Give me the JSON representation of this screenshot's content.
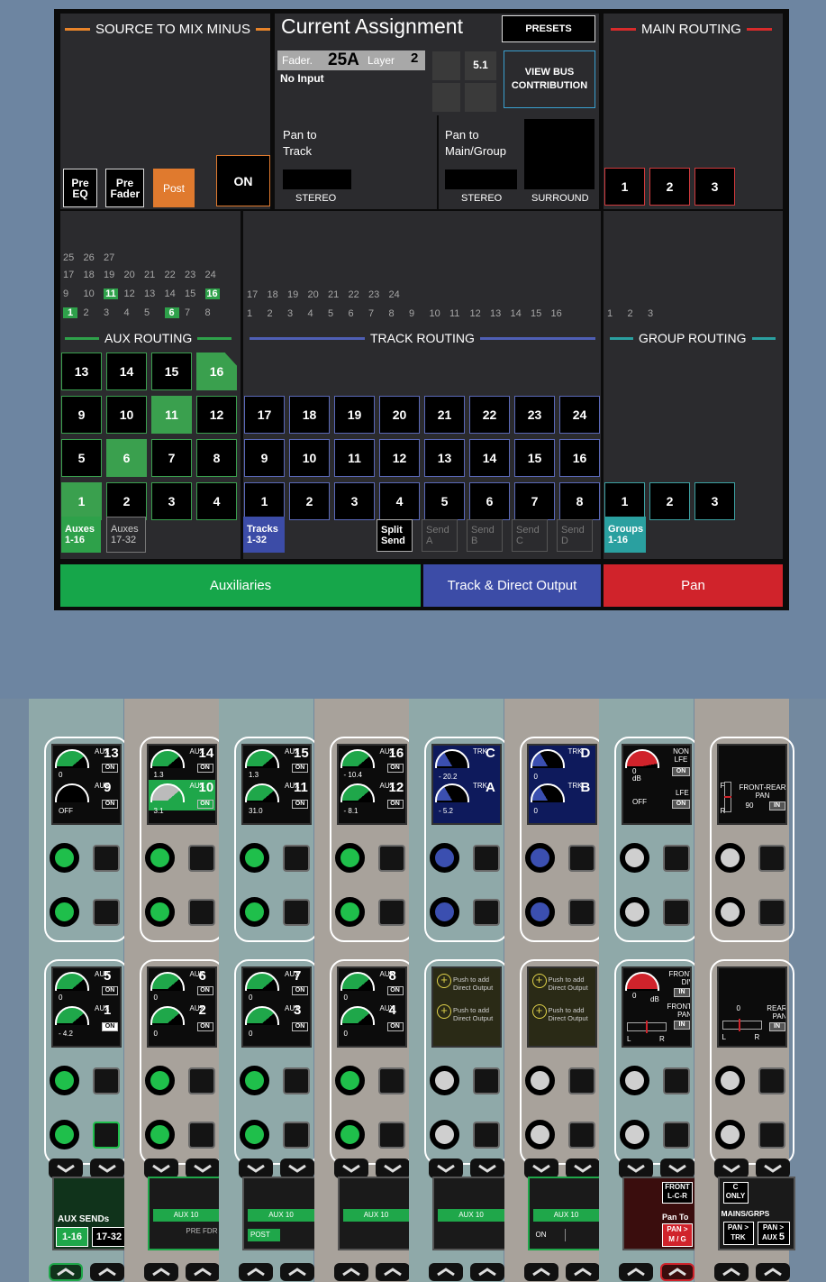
{
  "top": {
    "source_header": "SOURCE TO MIX MINUS",
    "current_assignment": "Current Assignment",
    "presets": "PRESETS",
    "main_routing": "MAIN ROUTING",
    "fader_label": "Fader.",
    "fader_value": "25A",
    "layer_label": "Layer",
    "layer_value": "2",
    "no_input": "No Input",
    "five_one": "5.1",
    "view_bus": "VIEW BUS CONTRIBUTION",
    "pan_to_track": "Pan to Track",
    "pan_to_main": "Pan to Main/Group",
    "stereo1": "STEREO",
    "stereo2": "STEREO",
    "surround": "SURROUND",
    "pre_eq": "Pre EQ",
    "pre_fader": "Pre Fader",
    "post": "Post",
    "on": "ON",
    "main_buttons": [
      "1",
      "2",
      "3"
    ],
    "aux_nums_row4": [
      "25",
      "26",
      "27"
    ],
    "aux_nums_row3": [
      "17",
      "18",
      "19",
      "20",
      "21",
      "22",
      "23",
      "24"
    ],
    "aux_nums_row2": [
      "9",
      "10",
      "11",
      "12",
      "13",
      "14",
      "15",
      "16"
    ],
    "aux_nums_row1": [
      "1",
      "2",
      "3",
      "4",
      "5",
      "6",
      "7",
      "8"
    ],
    "trk_nums_row2": [
      "17",
      "18",
      "19",
      "20",
      "21",
      "22",
      "23",
      "24"
    ],
    "trk_nums_row1": [
      "1",
      "2",
      "3",
      "4",
      "5",
      "6",
      "7",
      "8",
      "9",
      "10",
      "11",
      "12",
      "13",
      "14",
      "15",
      "16"
    ],
    "grp_nums": [
      "1",
      "2",
      "3"
    ],
    "aux_routing": "AUX ROUTING",
    "track_routing": "TRACK ROUTING",
    "group_routing": "GROUP ROUTING",
    "aux_grid": [
      "13",
      "14",
      "15",
      "16",
      "9",
      "10",
      "11",
      "12",
      "5",
      "6",
      "7",
      "8",
      "1",
      "2",
      "3",
      "4"
    ],
    "track_grid": [
      "17",
      "18",
      "19",
      "20",
      "21",
      "22",
      "23",
      "24",
      "9",
      "10",
      "11",
      "12",
      "13",
      "14",
      "15",
      "16",
      "1",
      "2",
      "3",
      "4",
      "5",
      "6",
      "7",
      "8"
    ],
    "group_grid": [
      "1",
      "2",
      "3"
    ],
    "auxes_1_16": "Auxes 1-16",
    "auxes_17_32": "Auxes 17-32",
    "tracks_1_32": "Tracks 1-32",
    "split_send": "Split Send",
    "send_a": "Send A",
    "send_b": "Send B",
    "send_c": "Send C",
    "send_d": "Send D",
    "groups_1_16": "Groups 1-16",
    "tab_aux": "Auxiliaries",
    "tab_track": "Track & Direct Output",
    "tab_pan": "Pan",
    "colors": {
      "aux": "#16a64a",
      "track": "#3c4ca7",
      "pan": "#d0232b",
      "group": "#2aa0a0"
    }
  },
  "console": {
    "upper": [
      {
        "a": "13",
        "av": "0",
        "b": "9",
        "bv": "OFF"
      },
      {
        "a": "14",
        "av": "1.3",
        "b": "10",
        "bv": "3.1"
      },
      {
        "a": "15",
        "av": "1.3",
        "b": "11",
        "bv": "31.0"
      },
      {
        "a": "16",
        "av": "- 10.4",
        "b": "12",
        "bv": "- 8.1"
      }
    ],
    "lower": [
      {
        "a": "5",
        "av": "0",
        "b": "1",
        "bv": "- 4.2"
      },
      {
        "a": "6",
        "av": "0",
        "b": "2",
        "bv": "0"
      },
      {
        "a": "7",
        "av": "0",
        "b": "3",
        "bv": "0"
      },
      {
        "a": "8",
        "av": "0",
        "b": "4",
        "bv": "0"
      }
    ],
    "aux_tag": "AUX",
    "on_tag": "ON",
    "trk_tag": "TRK",
    "trk_c": "C",
    "trk_a": "A",
    "trk_d": "D",
    "trk_b": "B",
    "trk_c_val": "- 20.2",
    "trk_a_val": "- 5.2",
    "trk_d_val": "0",
    "trk_b_val": "0",
    "push_direct": "Push to add Direct Output",
    "non_lfe": "NON LFE",
    "lfe": "LFE",
    "dB": "dB",
    "off": "OFF",
    "zero": "0",
    "front_rear_pan": "FRONT-REAR PAN",
    "ninety": "90",
    "front_div": "FRONT DIV",
    "front_pan": "FRONT PAN",
    "rear_pan": "REAR PAN",
    "in_tag": "IN",
    "L": "L",
    "R": "R",
    "F": "F",
    "aux_sends": "AUX SENDs",
    "btn_1_16": "1-16",
    "btn_17_32": "17-32",
    "aux10": "AUX 10",
    "pre_fdr": "PRE FDR",
    "post": "POST",
    "on": "ON",
    "front_lcr": "FRONT L-C-R",
    "pan_to": "Pan To",
    "pan_mg": "PAN > M / G",
    "c_only": "C ONLY",
    "mains_grps": "MAINS/GRPS",
    "pan_trk": "PAN > TRK",
    "pan_aux": "PAN > AUX",
    "pan_aux_num": "5"
  }
}
